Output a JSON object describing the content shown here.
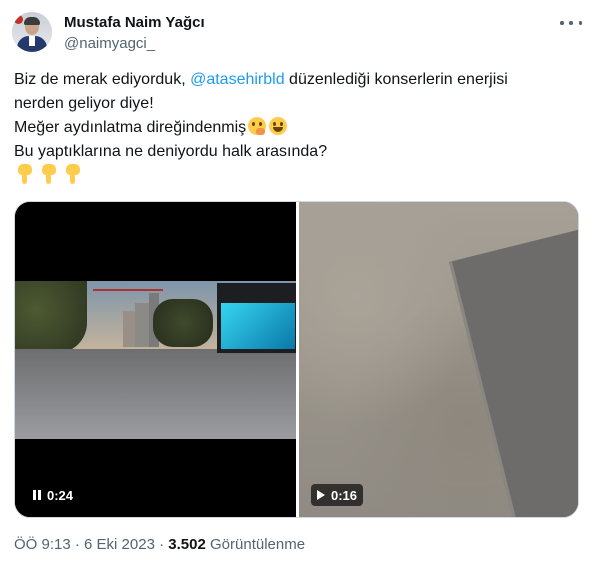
{
  "author": {
    "name": "Mustafa Naim Yağcı",
    "handle": "@naimyagci_"
  },
  "tweet": {
    "line1_before": "Biz de merak ediyorduk, ",
    "mention": "@atasehirbld",
    "line1_after": " düzenlediği konserlerin enerjisi",
    "line2": "nerden geliyor diye!",
    "line3": "Meğer aydınlatma direğindenmiş",
    "line4": "Bu yaptıklarına ne deniyordu halk arasında?",
    "emojis_line3": [
      "thinking-face-emoji",
      "grinning-face-emoji"
    ],
    "emojis_line5": [
      "backhand-index-pointing-down-emoji",
      "backhand-index-pointing-down-emoji",
      "backhand-index-pointing-down-emoji"
    ]
  },
  "media": {
    "video1": {
      "state": "playing",
      "time": "0:24"
    },
    "video2": {
      "state": "paused",
      "time": "0:16"
    }
  },
  "footer": {
    "time": "ÖÖ 9:13",
    "separator": "·",
    "date": "6 Eki 2023",
    "views_count": "3.502",
    "views_label": "Görüntülenme"
  },
  "colors": {
    "link": "#1d9bf0",
    "text": "#0f1419",
    "secondary": "#536471"
  }
}
